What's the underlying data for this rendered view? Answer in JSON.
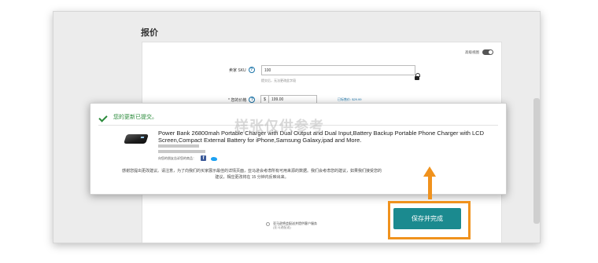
{
  "page": {
    "section_title": "报价"
  },
  "advanced": {
    "label": "高级视图"
  },
  "sku": {
    "label": "卖家 SKU",
    "value": "100",
    "hint": "提交后，无法更改此字段"
  },
  "price": {
    "label": "* 您的价格",
    "currency": "$",
    "value": "199.00",
    "list_price": "已标售价: $29.99"
  },
  "fulfillment": {
    "option_label": "亚马逊将会配送并提供客户服务",
    "option_sub": "(亚马逊配送)"
  },
  "popup": {
    "header": "您的更新已提交。",
    "product_title": "Power Bank 26800mah Portable Charger with Dual Output and Dual Input,Battery Backup Portable Phone Charger with LCD Screen,Compact External Battery for iPhone,Samsung Galaxy,ipad and More.",
    "share_text": "向您的朋友告诉您的商品：",
    "note": "感谢您提出更改建议。请注意，为了向我们的买家展示最佳的详情页面，亚马逊会考虑所有可用来源的数据。我们会考虑您的建议，如果我们接受您的建议，相应更改将在 15 分钟内反映出来。"
  },
  "watermark": "样张仅供参考",
  "actions": {
    "save_label": "保存并完成"
  },
  "colors": {
    "accent": "#f0921d",
    "primary_button": "#1b8a8f",
    "success": "#2a8a3a"
  }
}
